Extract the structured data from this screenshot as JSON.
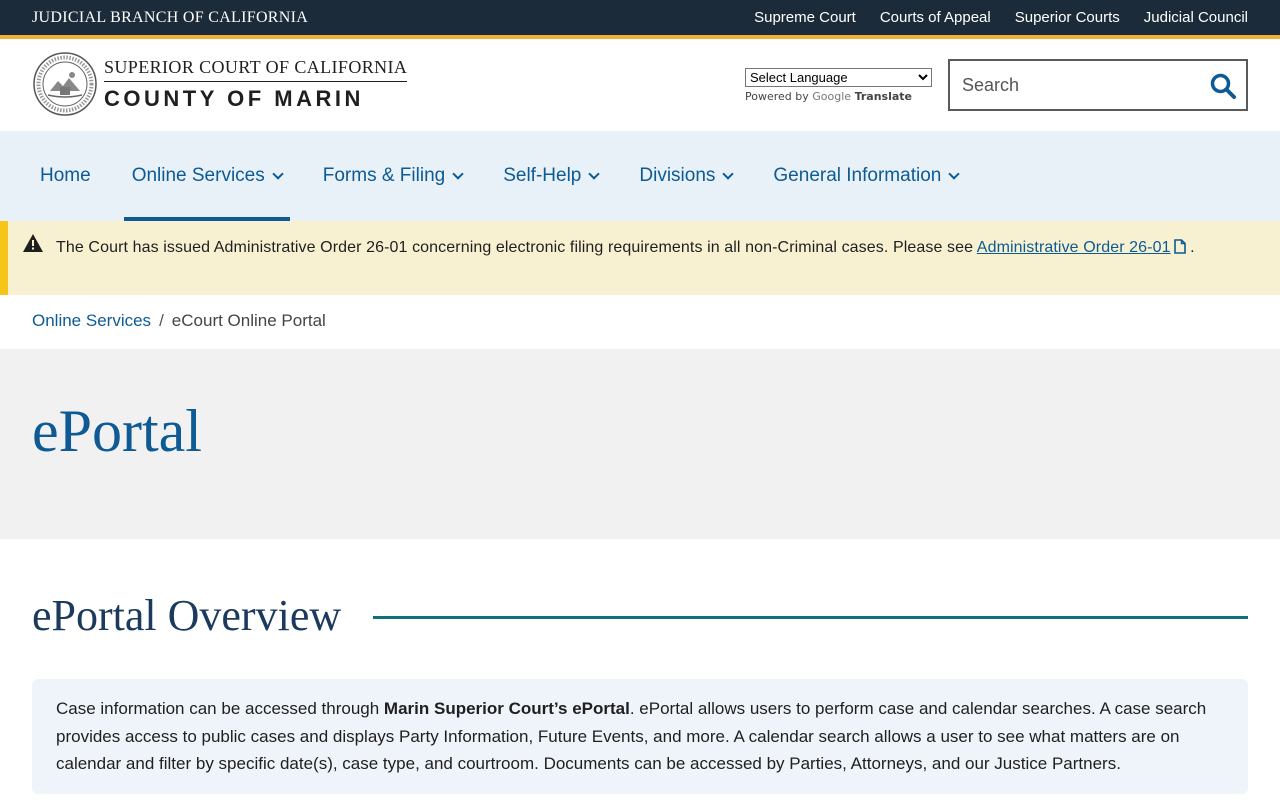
{
  "topbar": {
    "brand": "JUDICIAL BRANCH OF CALIFORNIA",
    "links": [
      "Supreme Court",
      "Courts of Appeal",
      "Superior Courts",
      "Judicial Council"
    ]
  },
  "header": {
    "logo_line1": "SUPERIOR COURT OF CALIFORNIA",
    "logo_line2": "COUNTY OF MARIN",
    "translate_select": "Select Language",
    "powered_by": "Powered by",
    "google": "Google",
    "translate_word": "Translate",
    "search_placeholder": "Search"
  },
  "nav": {
    "items": [
      {
        "label": "Home"
      },
      {
        "label": "Online Services"
      },
      {
        "label": "Forms & Filing"
      },
      {
        "label": "Self-Help"
      },
      {
        "label": "Divisions"
      },
      {
        "label": "General Information"
      }
    ]
  },
  "alert": {
    "text": "The Court has issued Administrative Order 26-01 concerning electronic filing requirements in all non-Criminal cases. Please see ",
    "link_text": "Administrative Order 26-01",
    "suffix": " ."
  },
  "breadcrumb": {
    "parent": "Online Services",
    "separator": "/",
    "current": "eCourt Online Portal"
  },
  "page": {
    "title": "ePortal",
    "section_title": "ePortal Overview",
    "info_prefix": "Case information can be accessed through ",
    "info_bold": "Marin Superior Court’s ePortal",
    "info_suffix": ". ePortal allows users to perform case and calendar searches. A case search provides access to public cases and displays Party Information, Future Events, and more. A calendar search allows a user to see what matters are on calendar and filter by specific date(s), case type, and courtroom. Documents can be accessed by Parties, Attorneys, and our Justice Partners."
  },
  "colors": {
    "topbar_bg": "#1c2b3a",
    "accent_gold": "#f2b134",
    "link_blue": "#0d5a94",
    "nav_bg": "#e8f1f8",
    "alert_bg": "#f7f1d1"
  }
}
